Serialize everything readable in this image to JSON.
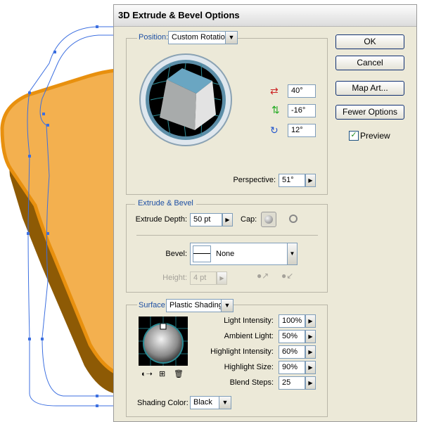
{
  "dialog": {
    "title": "3D Extrude & Bevel Options"
  },
  "buttons": {
    "ok": "OK",
    "cancel": "Cancel",
    "map_art": "Map Art...",
    "fewer_options": "Fewer Options"
  },
  "preview": {
    "label": "Preview",
    "checked": true
  },
  "position": {
    "label": "Position:",
    "preset": "Custom Rotation",
    "rotation_x": "40°",
    "rotation_y": "-16°",
    "rotation_z": "12°",
    "perspective_label": "Perspective:",
    "perspective": "51°"
  },
  "extrude": {
    "legend": "Extrude & Bevel",
    "depth_label": "Extrude Depth:",
    "depth": "50 pt",
    "cap_label": "Cap:",
    "bevel_label": "Bevel:",
    "bevel": "None",
    "height_label": "Height:",
    "height": "4 pt"
  },
  "surface": {
    "label": "Surface:",
    "type": "Plastic Shading",
    "light_intensity_label": "Light Intensity:",
    "light_intensity": "100%",
    "ambient_light_label": "Ambient Light:",
    "ambient_light": "50%",
    "highlight_intensity_label": "Highlight Intensity:",
    "highlight_intensity": "60%",
    "highlight_size_label": "Highlight Size:",
    "highlight_size": "90%",
    "blend_steps_label": "Blend Steps:",
    "blend_steps": "25",
    "shading_color_label": "Shading Color:",
    "shading_color": "Black"
  },
  "colors": {
    "accent": "#1d4fa3",
    "cube_top": "#6aa6c2",
    "artwork_light": "#f3b04f",
    "artwork_dark": "#8d5a05",
    "path": "#3c6fe0"
  }
}
